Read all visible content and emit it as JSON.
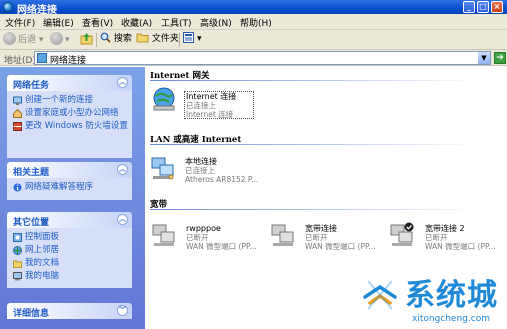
{
  "window": {
    "title": "网络连接"
  },
  "menu": [
    "文件(F)",
    "编辑(E)",
    "查看(V)",
    "收藏(A)",
    "工具(T)",
    "高级(N)",
    "帮助(H)"
  ],
  "toolbar": {
    "back": "后退",
    "search": "搜索",
    "folders": "文件夹"
  },
  "address": {
    "label": "地址(D)",
    "value": "网络连接"
  },
  "sidebar": {
    "network_tasks": {
      "title": "网络任务",
      "items": [
        "创建一个新的连接",
        "设置家庭或小型办公网络",
        "更改 Windows 防火墙设置"
      ]
    },
    "related": {
      "title": "相关主题",
      "items": [
        "网络疑难解答程序"
      ]
    },
    "other_places": {
      "title": "其它位置",
      "items": [
        "控制面板",
        "网上邻居",
        "我的文档",
        "我的电脑"
      ]
    },
    "details": {
      "title": "详细信息"
    }
  },
  "groups": {
    "internet_gateway": {
      "header": "Internet 网关",
      "item": {
        "name": "Internet 连接",
        "status": "已连接上",
        "device": "Internet 连接"
      }
    },
    "lan": {
      "header": "LAN 或高速 Internet",
      "item": {
        "name": "本地连接",
        "status": "已连接上",
        "device": "Atheros AR8152 P..."
      }
    },
    "broadband": {
      "header": "宽带",
      "items": [
        {
          "name": "rwpppoe",
          "status": "已断开",
          "device": "WAN 微型端口 (PP..."
        },
        {
          "name": "宽带连接",
          "status": "已断开",
          "device": "WAN 微型端口 (PP..."
        },
        {
          "name": "宽带连接 2",
          "status": "已断开",
          "device": "WAN 微型端口 (PP..."
        }
      ]
    }
  },
  "watermark": {
    "cn": "系统城",
    "en": "xitongcheng.com"
  },
  "colors": {
    "sidebar_link": "#215dc6",
    "title_bar": "#0a4fd0",
    "sidebar_bg": "#6f8ee0",
    "watermark": "#1f8ad8"
  }
}
